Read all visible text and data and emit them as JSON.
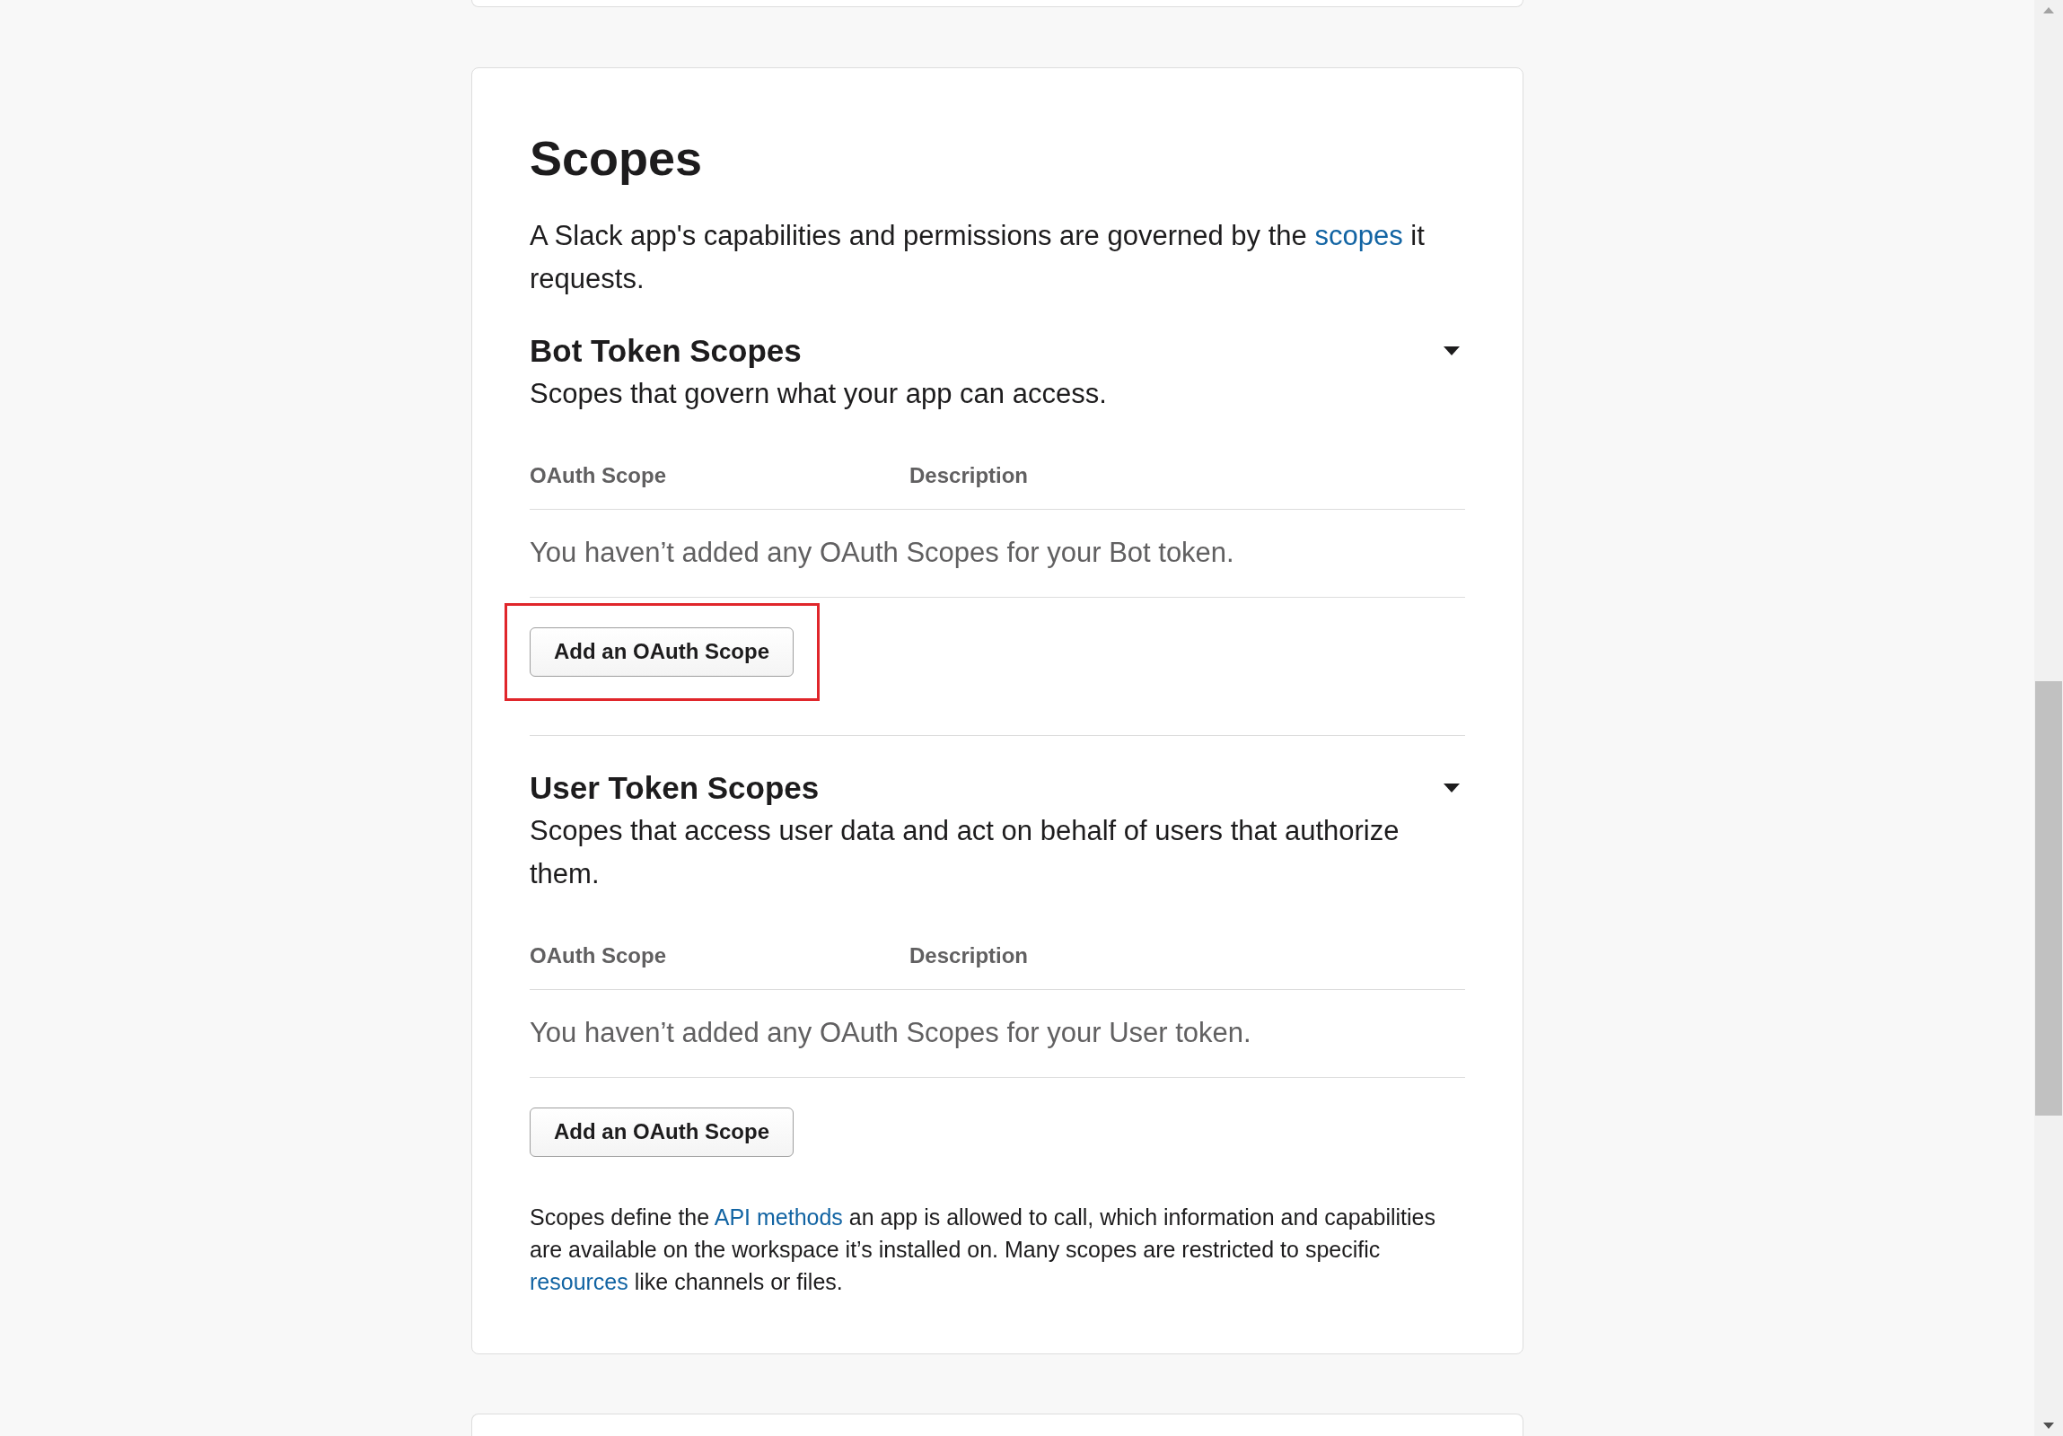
{
  "title": "Scopes",
  "intro": [
    {
      "kind": "text",
      "text": "A Slack app's capabilities and permissions are governed by the "
    },
    {
      "kind": "link",
      "text": "scopes"
    },
    {
      "kind": "text",
      "text": " it requests."
    }
  ],
  "sections": [
    {
      "title": "Bot Token Scopes",
      "description": "Scopes that govern what your app can access.",
      "expanded": true,
      "columns": [
        "OAuth Scope",
        "Description"
      ],
      "empty_message": "You haven’t added any OAuth Scopes for your Bot token.",
      "button": {
        "label": "Add an OAuth Scope",
        "highlighted": true
      }
    },
    {
      "title": "User Token Scopes",
      "description": "Scopes that access user data and act on behalf of users that authorize them.",
      "expanded": true,
      "columns": [
        "OAuth Scope",
        "Description"
      ],
      "empty_message": "You haven’t added any OAuth Scopes for your User token.",
      "button": {
        "label": "Add an OAuth Scope",
        "highlighted": false
      }
    }
  ],
  "footnote": [
    {
      "kind": "text",
      "text": "Scopes define the "
    },
    {
      "kind": "link",
      "text": "API methods"
    },
    {
      "kind": "text",
      "text": " an app is allowed to call, which information and capabilities are available on the workspace it’s installed on. Many scopes are restricted to specific "
    },
    {
      "kind": "link",
      "text": "resources"
    },
    {
      "kind": "text",
      "text": " like channels or files."
    }
  ]
}
